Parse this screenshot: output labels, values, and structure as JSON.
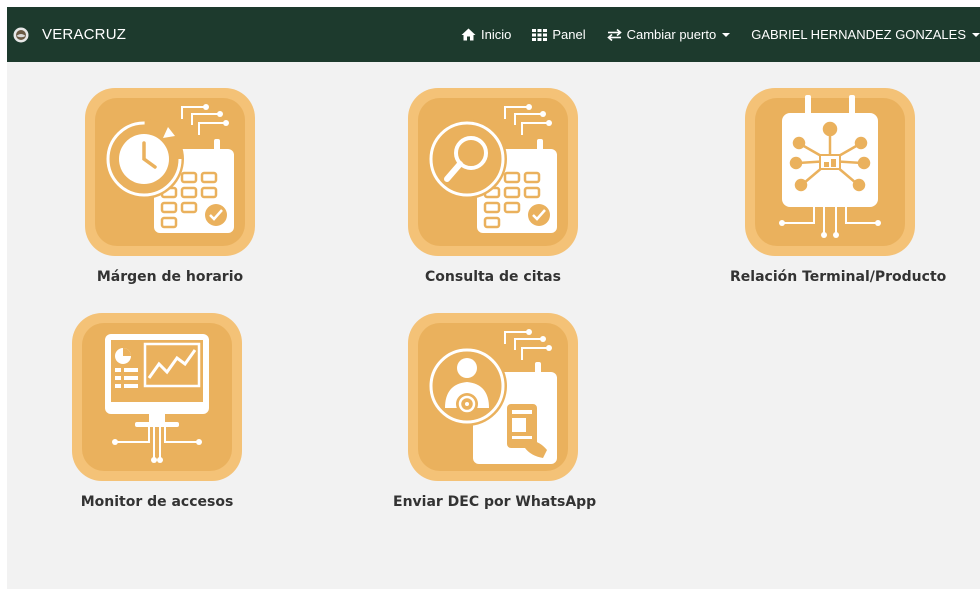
{
  "navbar": {
    "brand": "VERACRUZ",
    "brand_icon": "port-logo-icon",
    "items": [
      {
        "label": "Inicio",
        "icon": "home-icon"
      },
      {
        "label": "Panel",
        "icon": "grid-icon"
      },
      {
        "label": "Cambiar puerto",
        "icon": "exchange-icon"
      },
      {
        "label": "GABRIEL HERNANDEZ GONZALES",
        "icon": "caret-down-icon"
      }
    ]
  },
  "tiles": [
    {
      "label": "Márgen de horario",
      "icon": "clock-calendar-icon"
    },
    {
      "label": "Consulta de citas",
      "icon": "search-calendar-icon"
    },
    {
      "label": "Relación Terminal/Producto",
      "icon": "terminal-network-icon"
    },
    {
      "label": "Monitor de accesos",
      "icon": "monitor-chart-icon"
    },
    {
      "label": "Enviar DEC por WhatsApp",
      "icon": "driver-phone-icon"
    }
  ],
  "colors": {
    "navbar": "#1d3a2d",
    "tile_outer": "#f4c277",
    "tile_inner": "#eab15d",
    "background": "#f2f2f2"
  }
}
